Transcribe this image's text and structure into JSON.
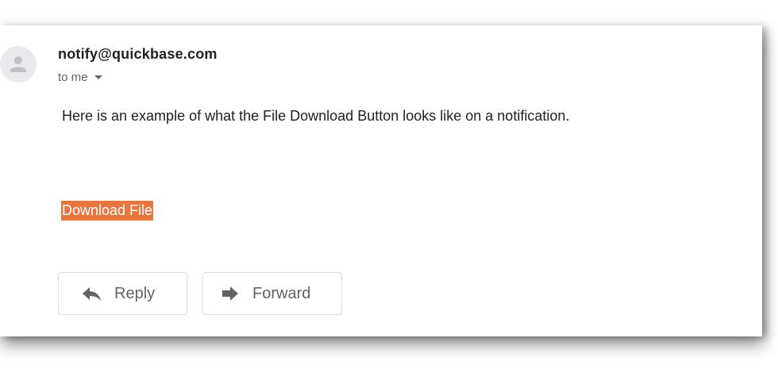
{
  "email": {
    "sender": "notify@quickbase.com",
    "recipient_label": "to me",
    "body": "Here is an example of what the File Download Button looks like on a notification.",
    "download_link_label": "Download File"
  },
  "actions": {
    "reply_label": "Reply",
    "forward_label": "Forward"
  },
  "icons": {
    "avatar": "person-avatar-icon",
    "recipient_dropdown": "chevron-down-icon",
    "reply": "reply-arrow-icon",
    "forward": "forward-arrow-icon"
  },
  "colors": {
    "download_button_bg": "#e8773f",
    "download_button_text": "#ffffff",
    "button_text": "#5f6368",
    "sender_text": "#202124"
  }
}
